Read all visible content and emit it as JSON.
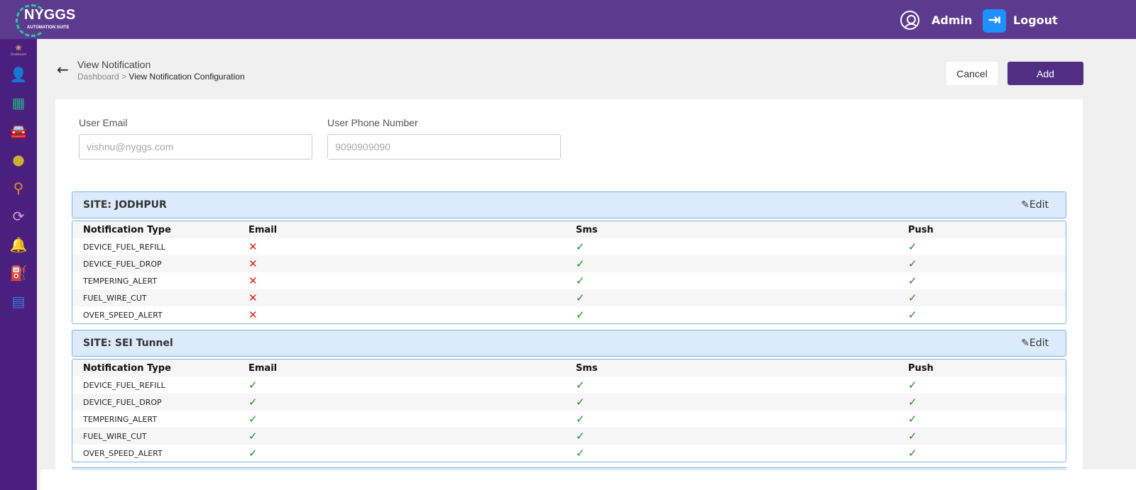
{
  "header": {
    "logo_text": "NYGGS",
    "logo_subtext": "AUTOMATION SUITE",
    "user_label": "Admin",
    "logout_label": "Logout"
  },
  "sidebar": {
    "items": [
      {
        "icon": "dashboard-icon",
        "label": "Dashboard",
        "glyph": "❀",
        "color": "#e8a080"
      },
      {
        "icon": "add-user-icon",
        "glyph": "👤",
        "color": "#3fa7d6"
      },
      {
        "icon": "store-icon",
        "glyph": "▦",
        "color": "#2aa889"
      },
      {
        "icon": "car-icon",
        "glyph": "🚘",
        "color": "#9fc0e6"
      },
      {
        "icon": "location-pin-icon",
        "glyph": "●",
        "color": "#c8b230"
      },
      {
        "icon": "route-icon",
        "glyph": "⚲",
        "color": "#e08a2a"
      },
      {
        "icon": "vehicle-sync-icon",
        "glyph": "⟳",
        "color": "#d9a0d9"
      },
      {
        "icon": "bell-settings-icon",
        "glyph": "🔔",
        "color": "#a45ad8"
      },
      {
        "icon": "fuel-pump-icon",
        "glyph": "⛽",
        "color": "#9ac23a"
      },
      {
        "icon": "report-icon",
        "glyph": "▤",
        "color": "#3a7ee0"
      }
    ]
  },
  "page": {
    "title": "View Notification",
    "breadcrumb": {
      "root": "Dashboard",
      "separator": ">",
      "current": "View Notification Configuration"
    },
    "cancel_label": "Cancel",
    "add_label": "Add"
  },
  "form": {
    "email_label": "User Email",
    "email_value": "vishnu@nyggs.com",
    "phone_label": "User Phone Number",
    "phone_value": "9090909090"
  },
  "table_headers": [
    "Notification Type",
    "Email",
    "Sms",
    "Push"
  ],
  "edit_label": "Edit",
  "sites": [
    {
      "title": "SITE: JODHPUR",
      "rows": [
        {
          "type": "DEVICE_FUEL_REFILL",
          "email": false,
          "sms": true,
          "push": true
        },
        {
          "type": "DEVICE_FUEL_DROP",
          "email": false,
          "sms": true,
          "push": true
        },
        {
          "type": "TEMPERING_ALERT",
          "email": false,
          "sms": true,
          "push": true
        },
        {
          "type": "FUEL_WIRE_CUT",
          "email": false,
          "sms": true,
          "push": true
        },
        {
          "type": "OVER_SPEED_ALERT",
          "email": false,
          "sms": true,
          "push": true
        }
      ]
    },
    {
      "title": "SITE: SEI Tunnel",
      "rows": [
        {
          "type": "DEVICE_FUEL_REFILL",
          "email": true,
          "sms": true,
          "push": true
        },
        {
          "type": "DEVICE_FUEL_DROP",
          "email": true,
          "sms": true,
          "push": true
        },
        {
          "type": "TEMPERING_ALERT",
          "email": true,
          "sms": true,
          "push": true
        },
        {
          "type": "FUEL_WIRE_CUT",
          "email": true,
          "sms": true,
          "push": true
        },
        {
          "type": "OVER_SPEED_ALERT",
          "email": true,
          "sms": true,
          "push": true
        }
      ]
    }
  ],
  "colors": {
    "header": "#5c3b8f",
    "sidebar": "#4a1f7e",
    "primary_button": "#512d84",
    "check": "#1f8a1f",
    "cross": "#e41b1b"
  }
}
